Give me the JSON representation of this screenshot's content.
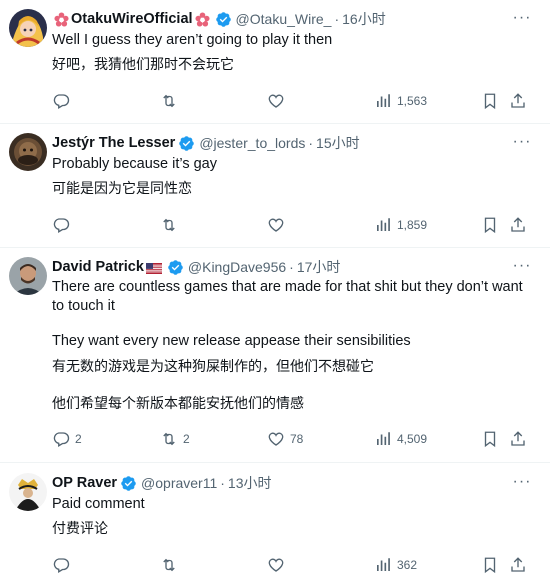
{
  "colors": {
    "accent": "#1d9bf0",
    "muted": "#536471",
    "text": "#0f1419",
    "divider": "#eff3f4"
  },
  "replies": [
    {
      "name": "OtakuWireOfficial",
      "handle": "@Otaku_Wire_",
      "separator": "·",
      "time": "16小时",
      "lines": [
        "Well I guess they aren’t going to play it then",
        "好吧，我猜他们那时不会玩它"
      ],
      "reply_count": "",
      "retweet_count": "",
      "like_count": "",
      "view_count": "1,563"
    },
    {
      "name": "Jestýr The Lesser",
      "handle": "@jester_to_lords",
      "separator": "·",
      "time": "15小时",
      "lines": [
        "Probably because it’s gay",
        "可能是因为它是同性恋"
      ],
      "reply_count": "",
      "retweet_count": "",
      "like_count": "",
      "view_count": "1,859"
    },
    {
      "name": "David Patrick",
      "handle": "@KingDave956",
      "separator": "·",
      "time": "17小时",
      "lines": [
        "There are countless games that are made for that shit but they don’t want",
        "to touch it",
        "They want every new release appease their sensibilities",
        "有无数的游戏是为这种狗屎制作的，但他们不想碰它",
        "他们希望每个新版本都能安抚他们的情感"
      ],
      "reply_count": "2",
      "retweet_count": "2",
      "like_count": "78",
      "view_count": "4,509"
    },
    {
      "name": "OP Raver",
      "handle": "@opraver11",
      "separator": "·",
      "time": "13小时",
      "lines": [
        "Paid comment",
        "付费评论"
      ],
      "reply_count": "",
      "retweet_count": "",
      "like_count": "",
      "view_count": "362"
    }
  ]
}
